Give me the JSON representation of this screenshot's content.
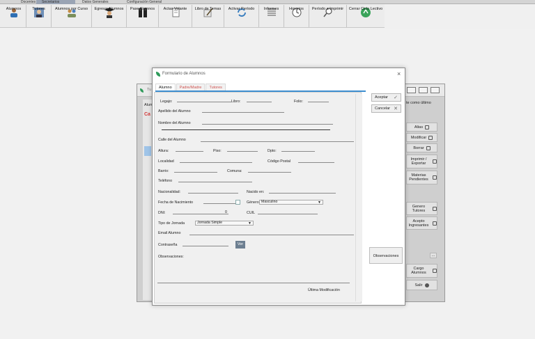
{
  "top_tabs": [
    "Docentes",
    "Secretarios",
    "Datos Generales",
    "Configuración General"
  ],
  "toolbar": [
    {
      "label": "Alumnos",
      "icon": "students-icon"
    },
    {
      "label": "Tutores",
      "icon": "tutors-icon"
    },
    {
      "label": "Alumnos por Curso",
      "icon": "course-students-icon"
    },
    {
      "label": "Egresar Alumnos",
      "icon": "graduate-icon"
    },
    {
      "label": "Pase Alumnos",
      "icon": "transfer-icon"
    },
    {
      "label": "Actas Volante",
      "icon": "minutes-icon"
    },
    {
      "label": "Libro de Temas",
      "icon": "book-pen-icon"
    },
    {
      "label": "Activar Período",
      "icon": "refresh-icon"
    },
    {
      "label": "Informes",
      "icon": "reports-icon"
    },
    {
      "label": "Horarios",
      "icon": "clock-icon"
    },
    {
      "label": "Período a Imprimir",
      "icon": "print-search-icon"
    },
    {
      "label": "Cerrar Ciclo Lectivo",
      "icon": "recycle-icon"
    }
  ],
  "background_window": {
    "title_prefix": "Tu",
    "tab_label": "Alum",
    "red_text": "Ca",
    "right_header": "te como último",
    "buttons": [
      {
        "label": "Altas"
      },
      {
        "label": "Modificar"
      },
      {
        "label": "Borrar"
      },
      {
        "label": "Imprimir / Exportar"
      },
      {
        "label": "Materias Pendientes"
      },
      {
        "label": "Genero Tutores"
      },
      {
        "label": "Acepto Ingresantes"
      },
      {
        "label": "..."
      },
      {
        "label": "Cargo Alumnos"
      },
      {
        "label": "Salir"
      }
    ]
  },
  "dialog": {
    "title": "Formulario de Alumnos",
    "close": "×",
    "tabs": [
      "Alumno",
      "Padre/Madre",
      "Tutores"
    ],
    "labels": {
      "legajo": "Legajo:",
      "libro": "Libro:",
      "folio": "Folio:",
      "apellido": "Apellido del Alumno",
      "nombre": "Nombre del Alumno",
      "calle": "Calle del Alumno",
      "altura": "Altura:",
      "piso": "Piso:",
      "dpto": "Dpto:",
      "localidad": "Localidad",
      "codigo_postal": "Código Postal",
      "barrio": "Barrio:",
      "comuna": "Comuna:",
      "telefono": "Teléfono",
      "nacionalidad": "Nacionalidad:",
      "nacido_en": "Nacido en:",
      "fecha_nacimiento": "Fecha de Nacimiento",
      "genero": "Género",
      "dni": "DNI:",
      "cuil": "CUIL",
      "tipo_jornada": "Tipo de Jornada",
      "email": "Email Alumno",
      "contrasena": "Contraseña",
      "observaciones": "Observaciones:",
      "ultima_modificacion": "Última Modificación"
    },
    "values": {
      "dni": "0",
      "genero": "Masculino",
      "tipo_jornada": "Jornada Simple"
    },
    "buttons": {
      "ver": "Ver",
      "aceptar": "Aceptar",
      "cancelar": "Cancelar",
      "observaciones": "Observaciones"
    }
  }
}
